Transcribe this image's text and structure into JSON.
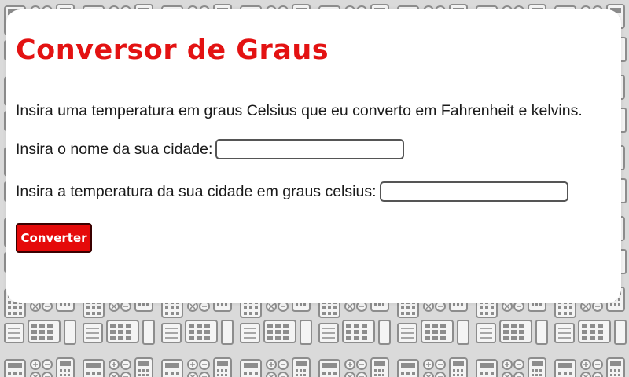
{
  "page": {
    "title": "Conversor de Graus",
    "intro": "Insira uma temperatura em graus Celsius que eu converto em Fahrenheit e kelvins."
  },
  "form": {
    "city_label": "Insira o nome da sua cidade:",
    "city_value": "",
    "temp_label": "Insira a temperatura da sua cidade em graus celsius:",
    "temp_value": "",
    "submit_label": "Converter"
  },
  "colors": {
    "accent": "#e31212",
    "button_bg": "#e50a0a",
    "background": "#d9d9d9",
    "card": "#ffffff"
  },
  "background_icons": [
    "calculator-icon"
  ]
}
